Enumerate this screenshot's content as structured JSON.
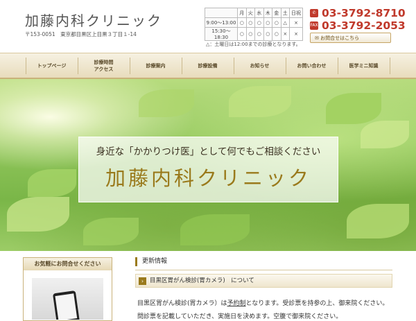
{
  "header": {
    "clinic_name": "加藤内科クリニック",
    "address": "〒153-0051　東京都目黒区上目黒３丁目１-14"
  },
  "hours": {
    "days": [
      "月",
      "火",
      "水",
      "木",
      "金",
      "土",
      "日祝"
    ],
    "rows": [
      {
        "slot": "9:00～13:00",
        "marks": [
          "○",
          "○",
          "○",
          "○",
          "○",
          "△",
          "×"
        ]
      },
      {
        "slot": "15:30～18:30",
        "marks": [
          "○",
          "○",
          "○",
          "○",
          "○",
          "×",
          "×"
        ]
      }
    ],
    "note": "△：土曜日は12:00までの診療となります。"
  },
  "contact": {
    "tel": "03-3792-8710",
    "fax_label": "FAX",
    "fax": "03-3792-2053",
    "button_label": "お問合せはこちら"
  },
  "nav": {
    "items": [
      {
        "label": "トップページ"
      },
      {
        "label": "診療時間\nアクセス"
      },
      {
        "label": "診療案内"
      },
      {
        "label": "診療設備"
      },
      {
        "label": "お知らせ"
      },
      {
        "label": "お問い合わせ"
      },
      {
        "label": "医学ミニ知識"
      }
    ]
  },
  "hero": {
    "tagline": "身近な「かかりつけ医」として何でもご相談ください",
    "title": "加藤内科クリニック"
  },
  "sidebar": {
    "heading": "お気軽にお問合せください"
  },
  "news": {
    "section_title": "更新情報",
    "item_title": "目黒区胃がん検診(胃カメラ)　について",
    "body_prefix": "目黒区胃がん検診(胃カメラ）は",
    "body_link": "予約制",
    "body_suffix": "となります。受診票を持参の上、御来院ください。",
    "body_line2": "問診票を記載していただき、実施日を決めます。空腹で御来院ください。"
  },
  "colors": {
    "accent_gold": "#9a7a1c",
    "phone_red": "#c0392b",
    "nav_bg": "#efe6cd"
  }
}
